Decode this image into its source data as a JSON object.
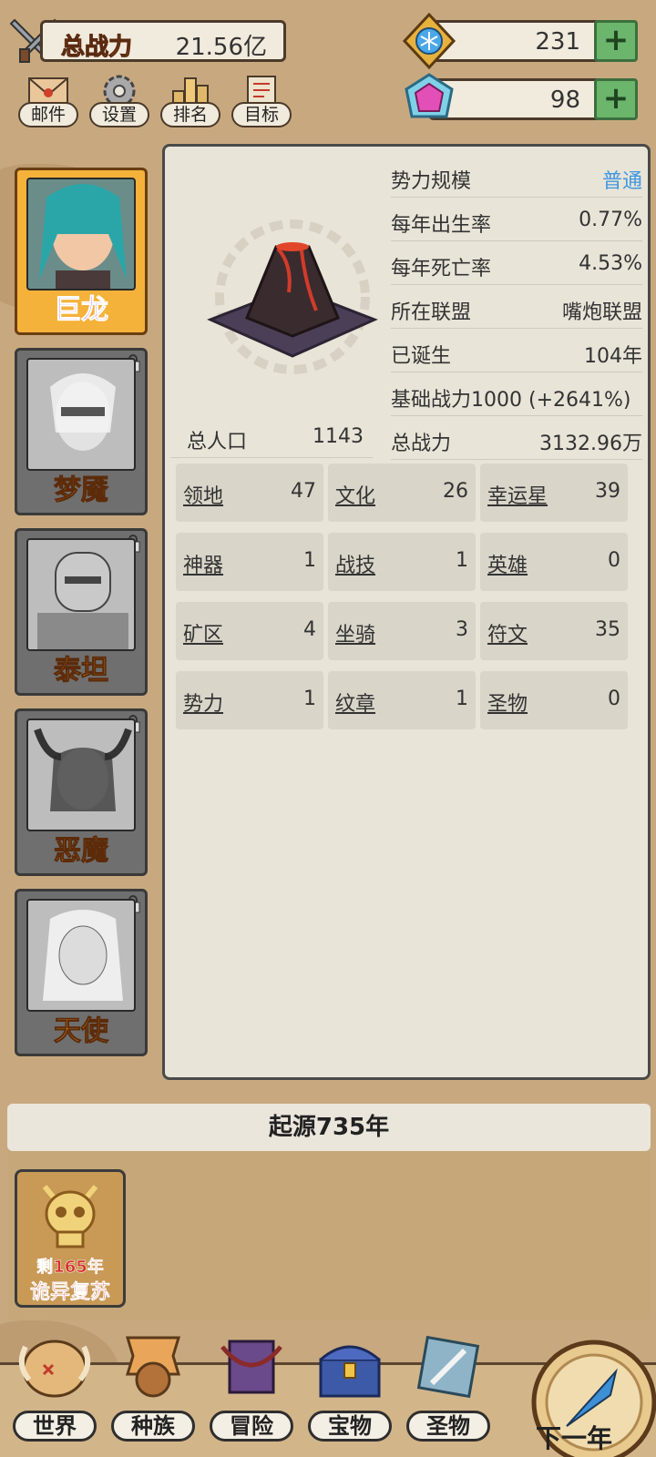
{
  "header": {
    "power_label": "总战力",
    "power_value": "21.56亿",
    "resources": [
      {
        "icon": "snowflake-gem-icon",
        "value": "231",
        "plus": "+"
      },
      {
        "icon": "pink-gem-icon",
        "value": "98",
        "plus": "+"
      }
    ],
    "menu": [
      {
        "icon": "mail-icon",
        "label": "邮件"
      },
      {
        "icon": "gear-icon",
        "label": "设置"
      },
      {
        "icon": "ranking-icon",
        "label": "排名"
      },
      {
        "icon": "scroll-icon",
        "label": "目标"
      }
    ]
  },
  "heroes": [
    {
      "name": "巨龙",
      "active": true
    },
    {
      "name": "梦魇",
      "locked": true
    },
    {
      "name": "泰坦",
      "locked": true
    },
    {
      "name": "恶魔",
      "locked": true
    },
    {
      "name": "天使",
      "locked": true
    }
  ],
  "details": {
    "stats": [
      {
        "key": "势力规模",
        "value": "普通"
      },
      {
        "key": "每年出生率",
        "value": "0.77%"
      },
      {
        "key": "每年死亡率",
        "value": "4.53%"
      },
      {
        "key": "所在联盟",
        "value": "嘴炮联盟"
      },
      {
        "key": "已诞生",
        "value": "104年"
      },
      {
        "key": "基础战力1000 (+2641%)",
        "value": ""
      },
      {
        "key": "总战力",
        "value": "3132.96万"
      }
    ],
    "population": {
      "key": "总人口",
      "value": "1143"
    },
    "grid": [
      {
        "key": "领地",
        "value": "47"
      },
      {
        "key": "文化",
        "value": "26"
      },
      {
        "key": "幸运星",
        "value": "39"
      },
      {
        "key": "神器",
        "value": "1"
      },
      {
        "key": "战技",
        "value": "1"
      },
      {
        "key": "英雄",
        "value": "0"
      },
      {
        "key": "矿区",
        "value": "4"
      },
      {
        "key": "坐骑",
        "value": "3"
      },
      {
        "key": "符文",
        "value": "35"
      },
      {
        "key": "势力",
        "value": "1"
      },
      {
        "key": "纹章",
        "value": "1"
      },
      {
        "key": "圣物",
        "value": "0"
      }
    ]
  },
  "origin": "起源735年",
  "event": {
    "line1": "剩165年",
    "line2": "诡异复苏"
  },
  "nav": [
    {
      "label": "世界"
    },
    {
      "label": "种族"
    },
    {
      "label": "冒险"
    },
    {
      "label": "宝物"
    },
    {
      "label": "圣物"
    }
  ],
  "next_label": "下一年",
  "colors": {
    "accent_blue": "#3f97e0",
    "hero_active": "#f4b23a",
    "name_orange": "#f6a831"
  }
}
